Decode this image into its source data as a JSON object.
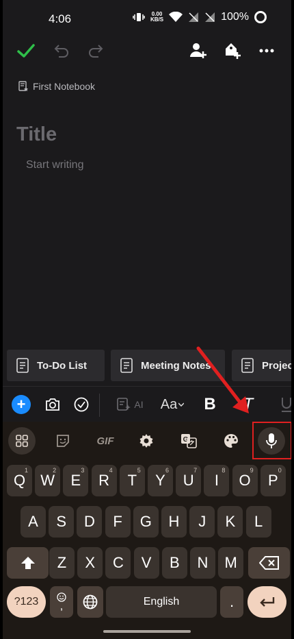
{
  "status_bar": {
    "time": "4:06",
    "net_speed_value": "0.00",
    "net_speed_unit": "KB/S",
    "battery": "100%"
  },
  "toolbar": {
    "done_icon": "check-icon",
    "undo_icon": "undo-icon",
    "redo_icon": "redo-icon",
    "share_icon": "add-person-icon",
    "tag_icon": "add-tag-icon",
    "more_icon": "more-horizontal-icon"
  },
  "note": {
    "notebook_label": "First Notebook",
    "title_placeholder": "Title",
    "body_placeholder": "Start writing"
  },
  "templates": [
    {
      "label": "To-Do List"
    },
    {
      "label": "Meeting Notes"
    },
    {
      "label": "Project"
    }
  ],
  "format_bar": {
    "ai_label": "AI",
    "text_size_label": "Aa",
    "bold_label": "B",
    "italic_label": "T"
  },
  "keyboard_toolbar": {
    "gif_label": "GIF"
  },
  "keyboard": {
    "row1": [
      {
        "key": "Q",
        "hint": "1"
      },
      {
        "key": "W",
        "hint": "2"
      },
      {
        "key": "E",
        "hint": "3"
      },
      {
        "key": "R",
        "hint": "4"
      },
      {
        "key": "T",
        "hint": "5"
      },
      {
        "key": "Y",
        "hint": "6"
      },
      {
        "key": "U",
        "hint": "7"
      },
      {
        "key": "I",
        "hint": "8"
      },
      {
        "key": "O",
        "hint": "9"
      },
      {
        "key": "P",
        "hint": "0"
      }
    ],
    "row2": [
      "A",
      "S",
      "D",
      "F",
      "G",
      "H",
      "J",
      "K",
      "L"
    ],
    "row3": [
      "Z",
      "X",
      "C",
      "V",
      "B",
      "N",
      "M"
    ],
    "symbols_label": "?123",
    "comma_label": ",",
    "space_label": "English",
    "period_label": "."
  },
  "colors": {
    "accent_green": "#2fbf4a",
    "accent_blue": "#1a8cff",
    "annotation_red": "#e02020",
    "enter_key": "#f2d3bf"
  }
}
